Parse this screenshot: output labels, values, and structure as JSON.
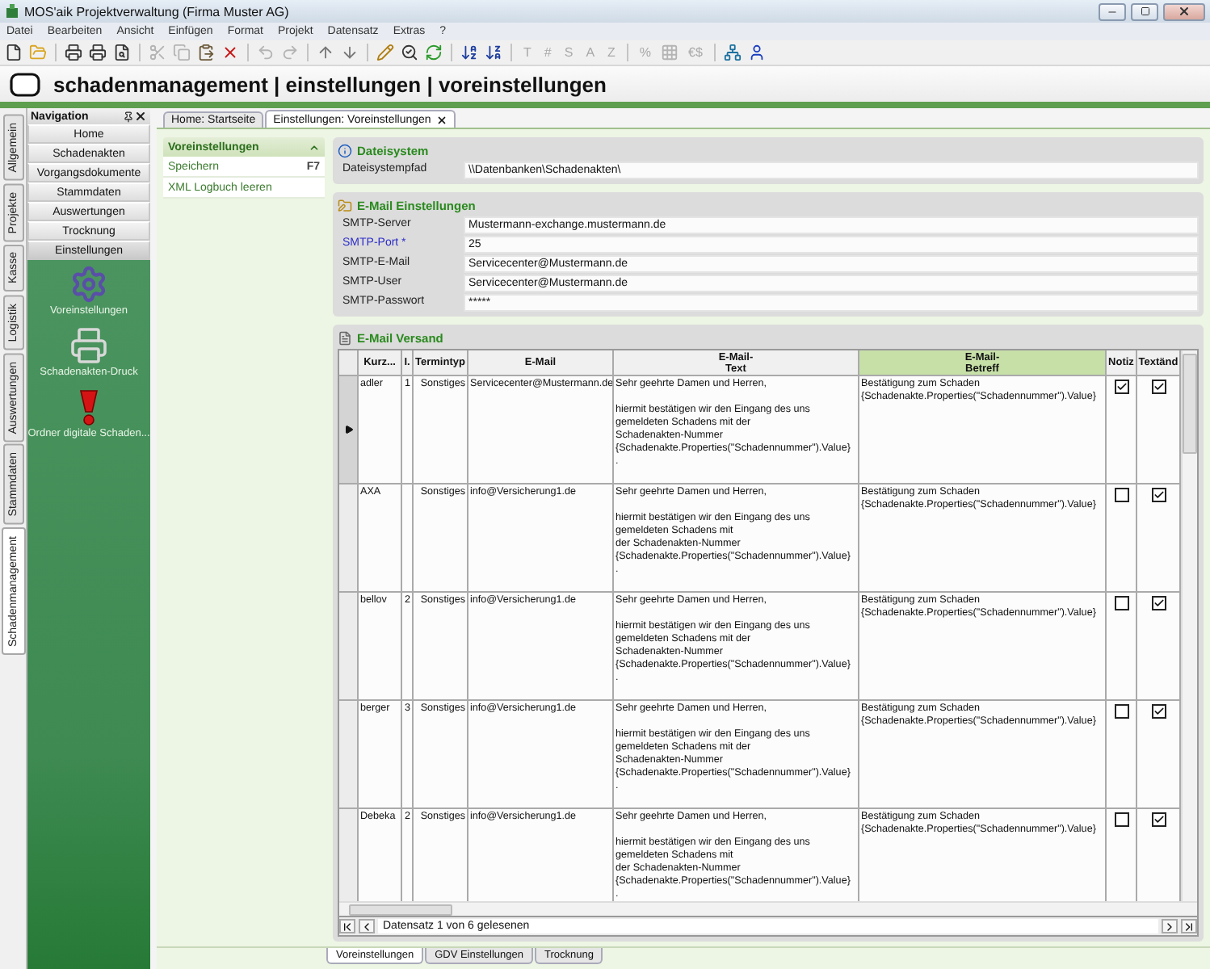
{
  "window": {
    "title": "MOS'aik Projektverwaltung (Firma Muster AG)"
  },
  "menu": [
    "Datei",
    "Bearbeiten",
    "Ansicht",
    "Einfügen",
    "Format",
    "Projekt",
    "Datensatz",
    "Extras",
    "?"
  ],
  "toolbar": [
    {
      "kind": "icon",
      "disabled": false
    },
    {
      "kind": "icon",
      "disabled": false
    },
    {
      "kind": "separator"
    },
    {
      "kind": "icon",
      "disabled": false
    },
    {
      "kind": "icon",
      "disabled": false
    },
    {
      "kind": "icon",
      "disabled": false
    },
    {
      "kind": "separator"
    },
    {
      "kind": "icon",
      "disabled": true
    },
    {
      "kind": "icon",
      "disabled": true
    },
    {
      "kind": "icon",
      "disabled": false
    },
    {
      "kind": "icon",
      "disabled": false
    },
    {
      "kind": "separator"
    },
    {
      "kind": "icon",
      "disabled": true
    },
    {
      "kind": "icon",
      "disabled": true
    },
    {
      "kind": "separator"
    },
    {
      "kind": "icon",
      "disabled": false
    },
    {
      "kind": "icon",
      "disabled": false
    },
    {
      "kind": "separator"
    },
    {
      "kind": "icon",
      "disabled": false
    },
    {
      "kind": "icon",
      "disabled": false
    },
    {
      "kind": "icon",
      "disabled": false
    },
    {
      "kind": "separator"
    },
    {
      "kind": "icon",
      "disabled": false
    },
    {
      "kind": "icon",
      "disabled": false
    },
    {
      "kind": "separator"
    },
    {
      "kind": "glyph",
      "text": "T",
      "disabled": true
    },
    {
      "kind": "glyph",
      "text": "#",
      "disabled": true
    },
    {
      "kind": "glyph",
      "text": "S",
      "disabled": true
    },
    {
      "kind": "glyph",
      "text": "A",
      "disabled": true
    },
    {
      "kind": "glyph",
      "text": "Z",
      "disabled": true
    },
    {
      "kind": "separator"
    },
    {
      "kind": "glyph",
      "text": "%",
      "disabled": true
    },
    {
      "kind": "icon",
      "disabled": true
    },
    {
      "kind": "glyph",
      "text": "€$",
      "disabled": true
    },
    {
      "kind": "separator"
    },
    {
      "kind": "icon",
      "disabled": false
    },
    {
      "kind": "icon",
      "disabled": false
    }
  ],
  "header": {
    "title": "schadenmanagement | einstellungen | voreinstellungen"
  },
  "side_tabs": [
    {
      "label": "Allgemein",
      "selected": false
    },
    {
      "label": "Projekte",
      "selected": false
    },
    {
      "label": "Kasse",
      "selected": false
    },
    {
      "label": "Logistik",
      "selected": false
    },
    {
      "label": "Auswertungen",
      "selected": false
    },
    {
      "label": "Stammdaten",
      "selected": false
    },
    {
      "label": "Schadenmanagement",
      "selected": true
    }
  ],
  "navigation": {
    "title": "Navigation",
    "items": [
      {
        "label": "Home",
        "selected": false
      },
      {
        "label": "Schadenakten",
        "selected": false
      },
      {
        "label": "Vorgangsdokumente",
        "selected": false
      },
      {
        "label": "Stammdaten",
        "selected": false
      },
      {
        "label": "Auswertungen",
        "selected": false
      },
      {
        "label": "Trocknung",
        "selected": false
      },
      {
        "label": "Einstellungen",
        "selected": true
      }
    ],
    "tools": [
      {
        "label": "Voreinstellungen"
      },
      {
        "label": "Schadenakten-Druck"
      },
      {
        "label": "Ordner digitale Schaden..."
      }
    ]
  },
  "doc_tabs": [
    {
      "label": "Home: Startseite",
      "selected": false,
      "closable": false
    },
    {
      "label": "Einstellungen: Voreinstellungen",
      "selected": true,
      "closable": true
    }
  ],
  "task_panel": {
    "title": "Voreinstellungen",
    "expanded": true,
    "items": [
      {
        "label": "Speichern",
        "shortcut": "F7"
      },
      {
        "label": "XML Logbuch leeren"
      }
    ]
  },
  "sections": [
    {
      "kind": "fields",
      "title": "Dateisystem",
      "fields": [
        {
          "label": "Dateisystempfad",
          "value": "\\\\Datenbanken\\Schadenakten\\",
          "required": false
        }
      ]
    },
    {
      "kind": "fields",
      "title": "E-Mail Einstellungen",
      "fields": [
        {
          "label": "SMTP-Server",
          "value": "Mustermann-exchange.mustermann.de",
          "required": false
        },
        {
          "label": "SMTP-Port *",
          "value": "25",
          "required": true
        },
        {
          "label": "SMTP-E-Mail",
          "value": "Servicecenter@Mustermann.de",
          "required": false
        },
        {
          "label": "SMTP-User",
          "value": "Servicecenter@Mustermann.de",
          "required": false
        },
        {
          "label": "SMTP-Passwort",
          "value": "*****",
          "required": false
        }
      ]
    },
    {
      "kind": "table",
      "title": "E-Mail Versand",
      "navigator": "Datensatz 1 von 6 gelesenen",
      "columns": [
        {
          "label": "Kurz...",
          "selected": false
        },
        {
          "label": "I.",
          "selected": false
        },
        {
          "label": "Termintyp",
          "selected": false
        },
        {
          "label": "E-Mail",
          "selected": false
        },
        {
          "label": "E-Mail-\nText",
          "selected": false
        },
        {
          "label": "E-Mail-\nBetreff",
          "selected": true
        },
        {
          "label": "Notiz",
          "selected": false
        },
        {
          "label": "Textänd",
          "selected": false
        }
      ],
      "rows": [
        {
          "selected": true,
          "kurz": "adler",
          "i": "1",
          "termintyp": "Sonstiges",
          "email": "Servicecenter@Mustermann.de",
          "text": "Sehr geehrte Damen und Herren,\n\nhiermit bestätigen wir den Eingang des uns\ngemeldeten Schadens mit der\nSchadenakten-Nummer\n{Schadenakte.Properties(\"Schadennummer\").Value}\n.",
          "betreff": "Bestätigung zum Schaden\n{Schadenakte.Properties(\"Schadennummer\").Value}",
          "notiz": true,
          "textaend": true
        },
        {
          "selected": false,
          "kurz": "AXA",
          "termintyp": "Sonstiges",
          "email": "info@Versicherung1.de",
          "text": "Sehr geehrte Damen und Herren,\n\nhiermit bestätigen wir den Eingang des uns\ngemeldeten Schadens mit\nder Schadenakten-Nummer\n{Schadenakte.Properties(\"Schadennummer\").Value}\n.",
          "betreff": "Bestätigung zum Schaden\n{Schadenakte.Properties(\"Schadennummer\").Value}",
          "notiz": false,
          "textaend": true
        },
        {
          "selected": false,
          "kurz": "bellov",
          "i": "2",
          "termintyp": "Sonstiges",
          "email": "info@Versicherung1.de",
          "text": "Sehr geehrte Damen und Herren,\n\nhiermit bestätigen wir den Eingang des uns\ngemeldeten Schadens mit der\nSchadenakten-Nummer\n{Schadenakte.Properties(\"Schadennummer\").Value}\n.",
          "betreff": "Bestätigung zum Schaden\n{Schadenakte.Properties(\"Schadennummer\").Value}",
          "notiz": false,
          "textaend": true
        },
        {
          "selected": false,
          "kurz": "berger",
          "i": "3",
          "termintyp": "Sonstiges",
          "email": "info@Versicherung1.de",
          "text": "Sehr geehrte Damen und Herren,\n\nhiermit bestätigen wir den Eingang des uns\ngemeldeten Schadens mit der\nSchadenakten-Nummer\n{Schadenakte.Properties(\"Schadennummer\").Value}\n.",
          "betreff": "Bestätigung zum Schaden\n{Schadenakte.Properties(\"Schadennummer\").Value}",
          "notiz": false,
          "textaend": true
        },
        {
          "selected": false,
          "kurz": "Debeka",
          "i": "2",
          "termintyp": "Sonstiges",
          "email": "info@Versicherung1.de",
          "text": "Sehr geehrte Damen und Herren,\n\nhiermit bestätigen wir den Eingang des uns\ngemeldeten Schadens mit\nder Schadenakten-Nummer\n{Schadenakte.Properties(\"Schadennummer\").Value}\n.",
          "betreff": "Bestätigung zum Schaden\n{Schadenakte.Properties(\"Schadennummer\").Value}",
          "notiz": false,
          "textaend": true
        }
      ]
    }
  ],
  "bottom_tabs": [
    {
      "label": "Voreinstellungen",
      "selected": true
    },
    {
      "label": "GDV Einstellungen",
      "selected": false
    },
    {
      "label": "Trocknung",
      "selected": false
    }
  ]
}
